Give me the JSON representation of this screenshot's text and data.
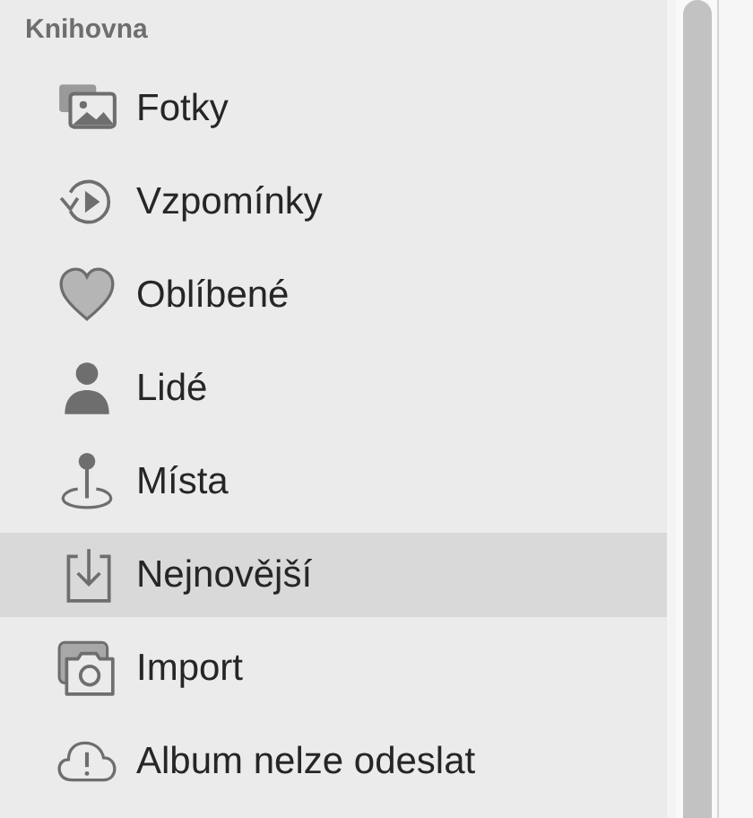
{
  "sidebar": {
    "section_title": "Knihovna",
    "items": [
      {
        "label": "Fotky",
        "selected": false
      },
      {
        "label": "Vzpomínky",
        "selected": false
      },
      {
        "label": "Oblíbené",
        "selected": false
      },
      {
        "label": "Lidé",
        "selected": false
      },
      {
        "label": "Místa",
        "selected": false
      },
      {
        "label": "Nejnovější",
        "selected": true
      },
      {
        "label": "Import",
        "selected": false
      },
      {
        "label": "Album nelze odeslat",
        "selected": false
      }
    ]
  }
}
